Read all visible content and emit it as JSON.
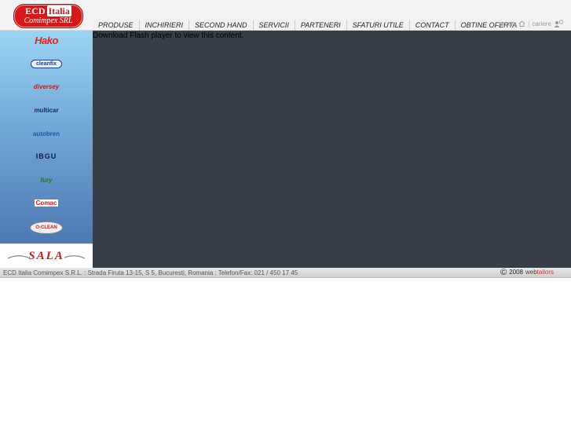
{
  "logo": {
    "line1": "ECD",
    "line1_box": "Italia",
    "line2": "Comimpex SRL"
  },
  "nav": {
    "items": [
      "PRODUSE",
      "INCHIRIERI",
      "SECOND HAND",
      "SERVICII",
      "PARTENERI",
      "SFATURI UTILE",
      "CONTACT",
      "OBTINE OFERTA"
    ]
  },
  "util": {
    "home": "acasa",
    "careers": "cariere"
  },
  "brands": {
    "hako": "Hako",
    "cleanfix": "cleanfix",
    "diversey": "diversey",
    "multicar": "multicar",
    "autobren": "autobren",
    "ibgu": "IBGU",
    "fury": "fury",
    "comac": "Comac",
    "oclean": "O-CLEAN",
    "sala": "SALA"
  },
  "flash": {
    "message": "Download Flash player to view this content."
  },
  "footer": {
    "address": "ECD Italia Comimpex S.R.L. : Strada Firuta 13-15, S 5, Bucuresti, Romania : Telefon/Fax: 021 / 450 17 45",
    "copyright_symbol": "©",
    "year": "2008",
    "brand_a": "web",
    "brand_b": "tailors"
  },
  "colors": {
    "logo_red": "#d81818",
    "flash_bg": "#363e47",
    "hako_red": "#e8231a"
  }
}
